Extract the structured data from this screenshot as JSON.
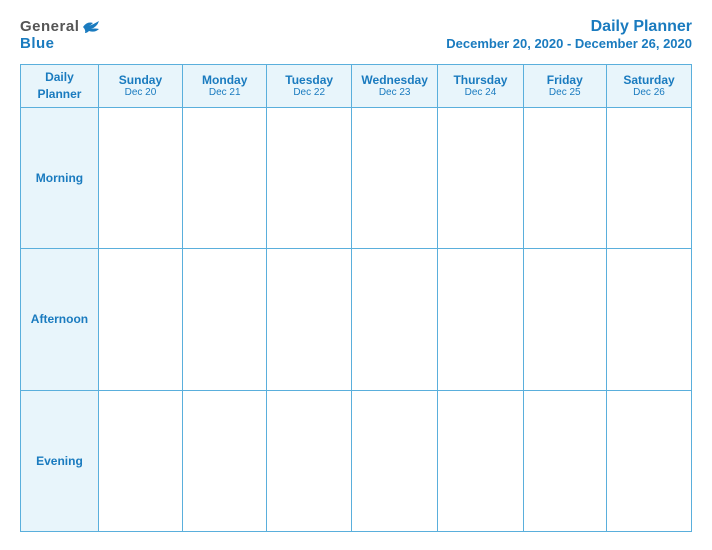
{
  "header": {
    "logo_general": "General",
    "logo_blue": "Blue",
    "title": "Daily Planner",
    "subtitle": "December 20, 2020 - December 26, 2020"
  },
  "columns": [
    {
      "id": "daily-planner-col",
      "day": "Daily",
      "day2": "Planner",
      "date": ""
    },
    {
      "id": "sunday-col",
      "day": "Sunday",
      "date": "Dec 20"
    },
    {
      "id": "monday-col",
      "day": "Monday",
      "date": "Dec 21"
    },
    {
      "id": "tuesday-col",
      "day": "Tuesday",
      "date": "Dec 22"
    },
    {
      "id": "wednesday-col",
      "day": "Wednesday",
      "date": "Dec 23"
    },
    {
      "id": "thursday-col",
      "day": "Thursday",
      "date": "Dec 24"
    },
    {
      "id": "friday-col",
      "day": "Friday",
      "date": "Dec 25"
    },
    {
      "id": "saturday-col",
      "day": "Saturday",
      "date": "Dec 26"
    }
  ],
  "rows": [
    {
      "id": "morning-row",
      "label": "Morning"
    },
    {
      "id": "afternoon-row",
      "label": "Afternoon"
    },
    {
      "id": "evening-row",
      "label": "Evening"
    }
  ]
}
